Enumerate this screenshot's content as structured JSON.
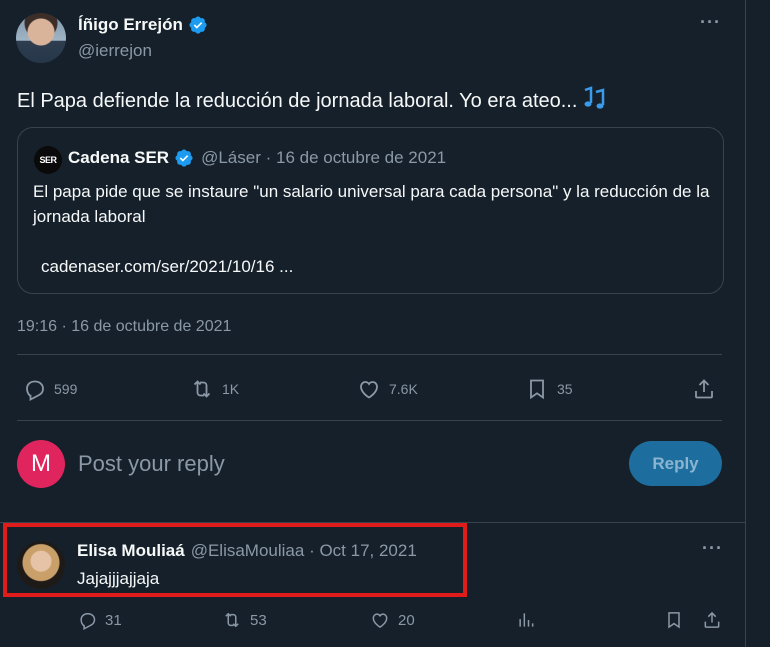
{
  "tweet": {
    "author_name": "Íñigo Errejón",
    "author_handle": "@ierrejon",
    "text": "El Papa defiende la reducción de jornada laboral. Yo era ateo...",
    "timestamp": "19:16 · 16 de octubre de 2021",
    "quote": {
      "logo_text": "SER",
      "author_name": "Cadena SER",
      "meta": "@Láser · 16 de octubre de 2021",
      "text": "El papa pide que se instaure \"un salario universal para cada persona\" y la reducción de la jornada laboral",
      "link": "cadenaser.com/ser/2021/10/16 ..."
    },
    "stats": {
      "replies": "599",
      "retweets": "1K",
      "likes": "7.6K",
      "bookmarks": "35"
    }
  },
  "composer": {
    "avatar_letter": "M",
    "placeholder": "Post your reply",
    "button_label": "Reply"
  },
  "reply": {
    "author_name": "Elisa Mouliaá",
    "meta": "@ElisaMouliaa · Oct 17, 2021",
    "text": "Jajajjjajjaja",
    "stats": {
      "replies": "31",
      "retweets": "53",
      "likes": "20"
    }
  },
  "colors": {
    "background": "#15202b",
    "accent": "#1d9bf0",
    "muted": "#8b98a5",
    "highlight": "#e01b1b",
    "composer_avatar": "#e0245e"
  }
}
